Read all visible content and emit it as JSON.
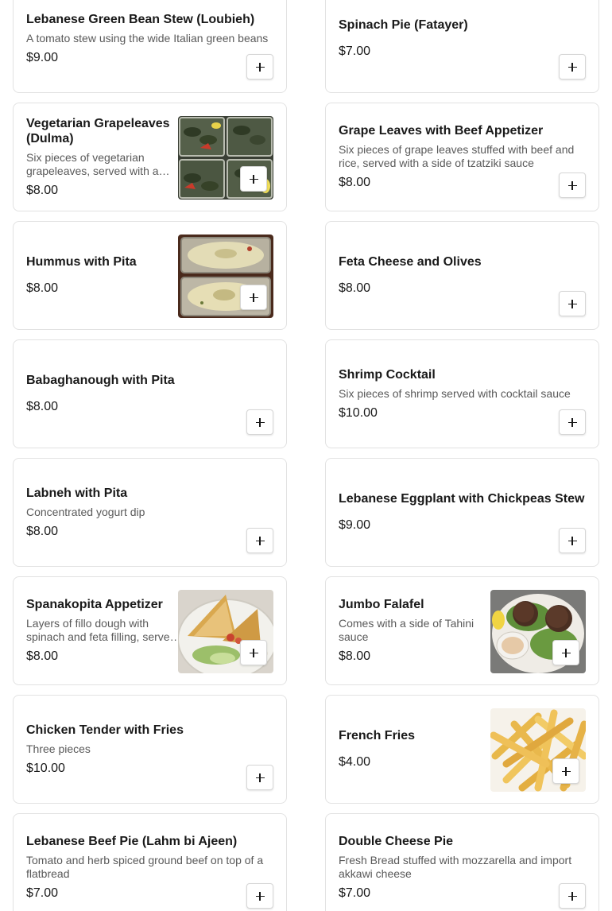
{
  "menu": {
    "items": [
      {
        "name": "Lebanese Green Bean Stew (Loubieh)",
        "desc": "A tomato stew using the wide Italian green beans",
        "price": "$9.00"
      },
      {
        "name": "Spinach Pie (Fatayer)",
        "desc": "",
        "price": "$7.00"
      },
      {
        "name": "Vegetarian Grapeleaves (Dulma)",
        "desc": "Six pieces of vegetarian grapeleaves, served with a side of tzatziki sauce",
        "price": "$8.00",
        "image": "grape-leaves-photo"
      },
      {
        "name": "Grape Leaves with Beef Appetizer",
        "desc": "Six pieces of grape leaves stuffed with beef and rice, served with a side of tzatziki sauce",
        "price": "$8.00"
      },
      {
        "name": "Hummus with Pita",
        "desc": "",
        "price": "$8.00",
        "image": "hummus-photo"
      },
      {
        "name": "Feta Cheese and Olives",
        "desc": "",
        "price": "$8.00"
      },
      {
        "name": "Babaghanough with Pita",
        "desc": "",
        "price": "$8.00"
      },
      {
        "name": "Shrimp Cocktail",
        "desc": "Six pieces of shrimp served with cocktail sauce",
        "price": "$10.00"
      },
      {
        "name": "Labneh with Pita",
        "desc": "Concentrated yogurt dip",
        "price": "$8.00"
      },
      {
        "name": "Lebanese Eggplant with Chickpeas Stew",
        "desc": "",
        "price": "$9.00"
      },
      {
        "name": "Spanakopita Appetizer",
        "desc": "Layers of fillo dough with spinach and feta filling, served with a side salad",
        "price": "$8.00",
        "image": "spanakopita-photo"
      },
      {
        "name": "Jumbo Falafel",
        "desc": "Comes with a side of Tahini sauce",
        "price": "$8.00",
        "image": "falafel-photo"
      },
      {
        "name": "Chicken Tender with Fries",
        "desc": "Three pieces",
        "price": "$10.00"
      },
      {
        "name": "French Fries",
        "desc": "",
        "price": "$4.00",
        "image": "fries-photo"
      },
      {
        "name": "Lebanese Beef Pie (Lahm bi Ajeen)",
        "desc": "Tomato and herb spiced ground beef on top of a flatbread",
        "price": "$7.00"
      },
      {
        "name": "Double Cheese Pie",
        "desc": "Fresh Bread stuffed with mozzarella and import akkawi cheese",
        "price": "$7.00"
      }
    ]
  },
  "icons": {
    "add": "plus-icon"
  },
  "colors": {
    "text": "#191919",
    "desc": "#595959",
    "border": "#e2e2e2",
    "background": "#ffffff"
  }
}
